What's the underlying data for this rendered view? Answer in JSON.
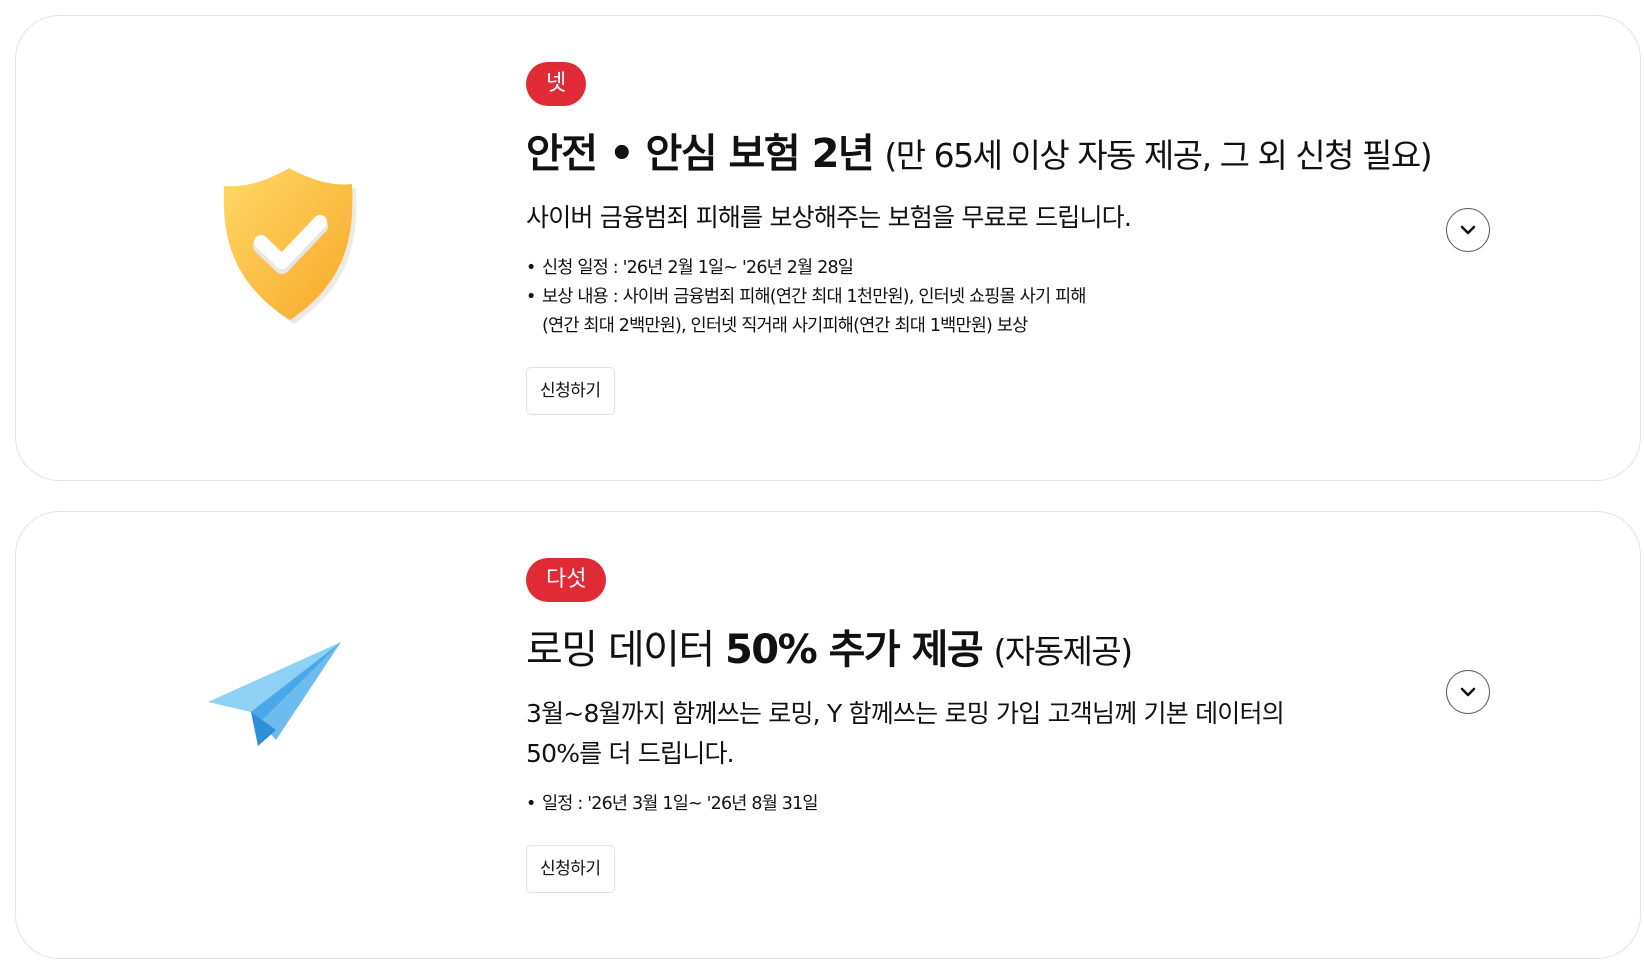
{
  "cards": [
    {
      "badge": "넷",
      "title_strong": "안전 • 안심 보험 2년",
      "title_light": "(만 65세 이상 자동 제공, 그 외 신청 필요)",
      "description": "사이버 금융범죄 피해를 보상해주는 보험을 무료로 드립니다.",
      "bullets": [
        {
          "line1": "신청 일정 : '26년 2월 1일~ '26년 2월 28일"
        },
        {
          "line1": "보상 내용 : 사이버 금융범죄 피해(연간 최대 1천만원), 인터넷 쇼핑몰 사기 피해",
          "line2": "(연간 최대 2백만원), 인터넷 직거래 사기피해(연간 최대 1백만원) 보상"
        }
      ],
      "apply_label": "신청하기",
      "icon": "shield-check-icon",
      "icon_colors": {
        "shield": "#fbb940",
        "shield_rim": "#f5f1ea",
        "check": "#ffffff"
      }
    },
    {
      "badge": "다섯",
      "title_light_prefix": "로밍 데이터 ",
      "title_strong": "50% 추가 제공",
      "title_light": "(자동제공)",
      "description_line1": "3월~8월까지 함께쓰는 로밍, Y 함께쓰는 로밍 가입 고객님께 기본 데이터의",
      "description_line2": "50%를 더 드립니다.",
      "bullets": [
        {
          "line1": "일정 : '26년 3월 1일~ '26년 8월 31일"
        }
      ],
      "apply_label": "신청하기",
      "icon": "paper-plane-icon",
      "icon_colors": {
        "plane_light": "#8fd0f5",
        "plane_dark": "#3fa3e6"
      }
    }
  ],
  "colors": {
    "badge": "#e02b37",
    "border": "#e3e3e3",
    "text": "#111111"
  },
  "toggle_icon": "chevron-down-icon"
}
